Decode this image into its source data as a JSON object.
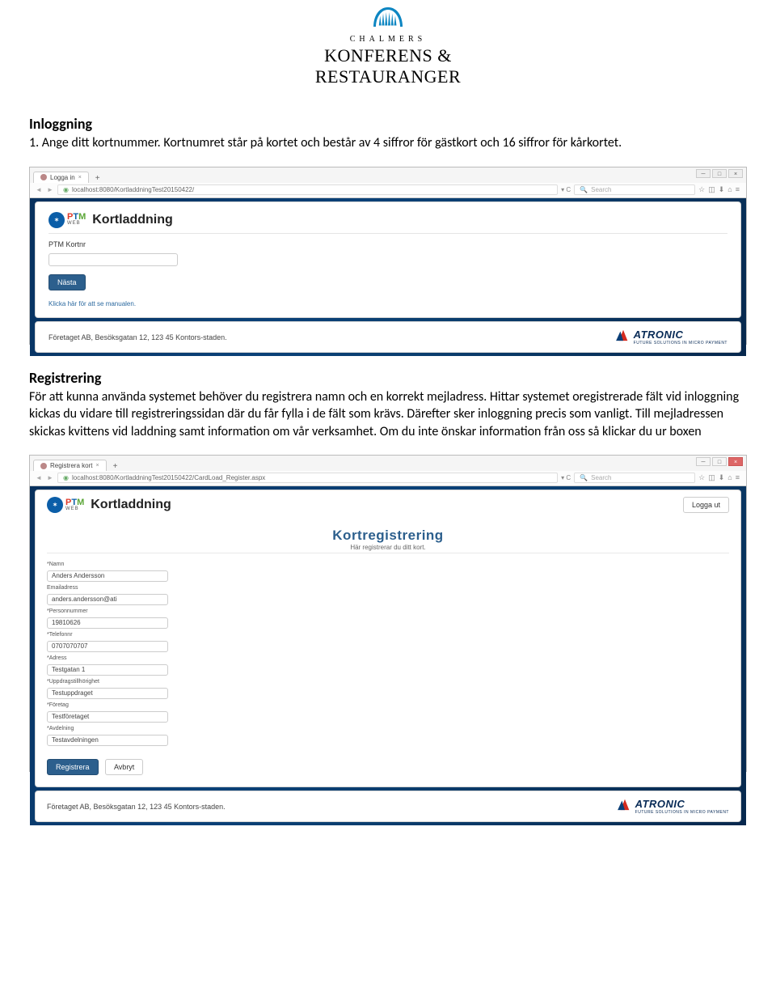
{
  "logo": {
    "line1": "CHALMERS",
    "line2": "KONFERENS &",
    "line3": "RESTAURANGER"
  },
  "section1": {
    "title": "Inloggning",
    "body": "1. Ange ditt kortnummer. Kortnumret står på kortet och består av 4 siffror för gästkort och 16 siffror för kårkortet."
  },
  "shot1": {
    "tab_title": "Logga in",
    "url": "localhost:8080/KortladdningTest20150422/",
    "search_placeholder": "Search",
    "panel_title": "Kortladdning",
    "field_label": "PTM Kortnr",
    "next_button": "Nästa",
    "link": "Klicka här för att se manualen.",
    "footer_addr": "Företaget AB, Besöksgatan 12, 123 45 Kontors-staden.",
    "atronic_brand": "ATRONIC",
    "atronic_tag": "FUTURE SOLUTIONS IN MICRO PAYMENT"
  },
  "section2": {
    "title": "Registrering",
    "body": "För att kunna använda systemet behöver du registrera namn och en korrekt mejladress. Hittar systemet oregistrerade fält vid inloggning kickas du vidare till registreringssidan där du får fylla i de fält som krävs. Därefter sker inloggning precis som vanligt. Till mejladressen skickas kvittens vid laddning samt information om vår verksamhet. Om du inte önskar information från oss så klickar du ur boxen"
  },
  "shot2": {
    "tab_title": "Registrera kort",
    "url": "localhost:8080/KortladdningTest20150422/CardLoad_Register.aspx",
    "search_placeholder": "Search",
    "panel_title": "Kortladdning",
    "logout": "Logga ut",
    "reg_title": "Kortregistrering",
    "reg_sub": "Här registrerar du ditt kort.",
    "fields": [
      {
        "label": "*Namn",
        "value": "Anders Andersson"
      },
      {
        "label": "Emailadress",
        "value": "anders.andersson@ati"
      },
      {
        "label": "*Personnummer",
        "value": "19810626"
      },
      {
        "label": "*Telefonnr",
        "value": "0707070707"
      },
      {
        "label": "*Adress",
        "value": "Testgatan 1"
      },
      {
        "label": "*Uppdragstillhörighet",
        "value": "Testuppdraget"
      },
      {
        "label": "*Företag",
        "value": "Testföretaget"
      },
      {
        "label": "*Avdelning",
        "value": "Testavdelningen"
      }
    ],
    "register_button": "Registrera",
    "cancel_button": "Avbryt",
    "footer_addr": "Företaget AB, Besöksgatan 12, 123 45 Kontors-staden.",
    "atronic_brand": "ATRONIC",
    "atronic_tag": "FUTURE SOLUTIONS IN MICRO PAYMENT"
  }
}
